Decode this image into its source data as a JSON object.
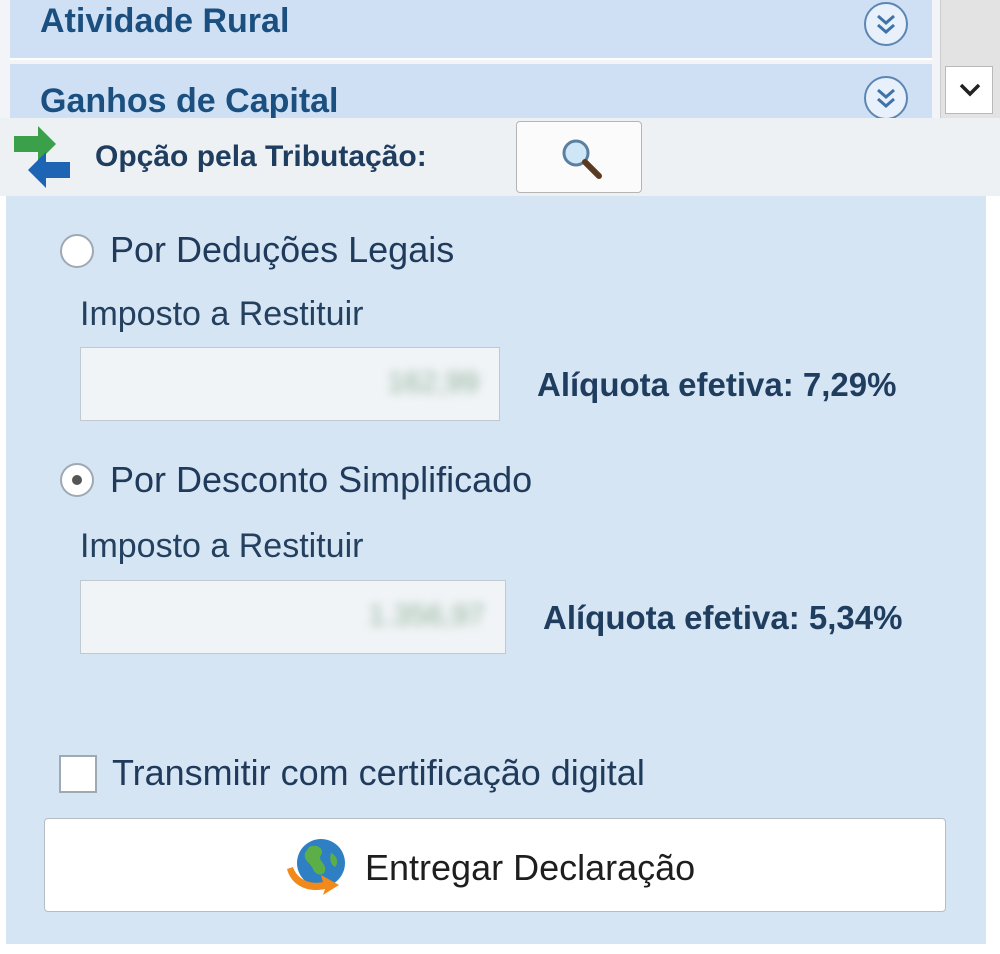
{
  "sections": [
    {
      "label": "Atividade Rural"
    },
    {
      "label": "Ganhos de Capital"
    }
  ],
  "taxation": {
    "title": "Opção pela Tributação:",
    "options": [
      {
        "label": "Por Deduções Legais",
        "selected": false,
        "field_label": "Imposto a Restituir",
        "value": "162,99",
        "rate_text": "Alíquota efetiva: 7,29%"
      },
      {
        "label": "Por Desconto Simplificado",
        "selected": true,
        "field_label": "Imposto a Restituir",
        "value": "1.356,97",
        "rate_text": "Alíquota efetiva: 5,34%"
      }
    ]
  },
  "transmit_digital_cert": {
    "label": "Transmitir com certificação digital",
    "checked": false
  },
  "submit": {
    "label": "Entregar Declaração"
  },
  "icons": {
    "expand": "double-chevron-down-icon",
    "scroll": "chevron-down-icon",
    "option": "swap-arrows-icon",
    "search": "magnifier-icon",
    "submit": "globe-send-icon"
  },
  "colors": {
    "section_bg": "#cfe0f5",
    "section_text": "#1b4f80",
    "panel_bg": "#d6e5f3",
    "title_text": "#1f3d5f"
  }
}
